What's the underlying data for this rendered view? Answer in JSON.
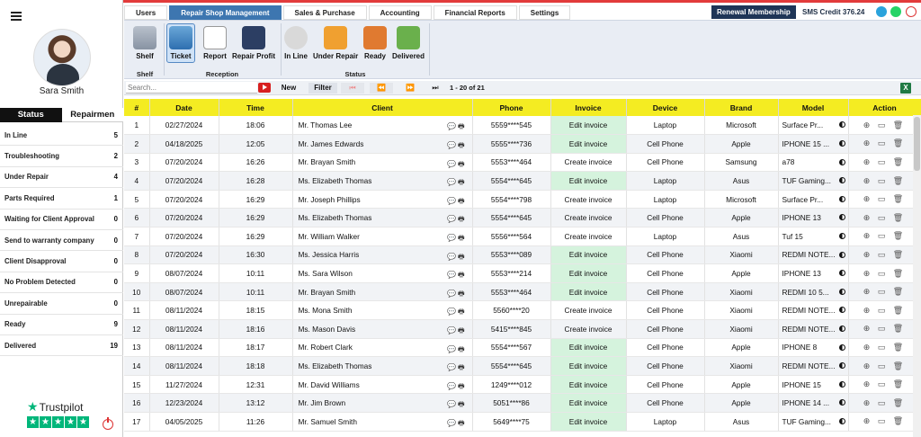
{
  "user": {
    "name": "Sara Smith"
  },
  "sidebar": {
    "tabs": [
      {
        "label": "Status"
      },
      {
        "label": "Repairmen"
      }
    ],
    "status_items": [
      {
        "label": "In Line",
        "count": "5"
      },
      {
        "label": "Troubleshooting",
        "count": "2"
      },
      {
        "label": "Under Repair",
        "count": "4"
      },
      {
        "label": "Parts Required",
        "count": "1"
      },
      {
        "label": "Waiting for Client Approval",
        "count": "0"
      },
      {
        "label": "Send to warranty company",
        "count": "0"
      },
      {
        "label": "Client Disapproval",
        "count": "0"
      },
      {
        "label": "No Problem Detected",
        "count": "0"
      },
      {
        "label": "Unrepairable",
        "count": "0"
      },
      {
        "label": "Ready",
        "count": "9"
      },
      {
        "label": "Delivered",
        "count": "19"
      }
    ],
    "trustpilot_label": "Trustpilot"
  },
  "nav": {
    "tabs": [
      {
        "label": "Users"
      },
      {
        "label": "Repair Shop Management"
      },
      {
        "label": "Sales & Purchase"
      },
      {
        "label": "Accounting"
      },
      {
        "label": "Financial Reports"
      },
      {
        "label": "Settings"
      }
    ],
    "active_tab": "Repair Shop Management",
    "renewal_label": "Renewal Membership",
    "sms_credit": "SMS Credit 376.24"
  },
  "ribbon": {
    "shelf_group": {
      "title": "Shelf",
      "buttons": [
        {
          "label": "Shelf",
          "icon": "shelf-icon"
        }
      ]
    },
    "reception_group": {
      "title": "Reception",
      "buttons": [
        {
          "label": "Ticket",
          "icon": "ticket-icon"
        },
        {
          "label": "Report",
          "icon": "report-icon"
        },
        {
          "label": "Repair Profit",
          "icon": "tools-icon"
        }
      ]
    },
    "status_group": {
      "title": "Status",
      "buttons": [
        {
          "label": "In Line",
          "icon": "clock-icon"
        },
        {
          "label": "Under Repair",
          "icon": "wrench-icon"
        },
        {
          "label": "Ready",
          "icon": "box-icon"
        },
        {
          "label": "Delivered",
          "icon": "delivered-icon"
        }
      ]
    }
  },
  "toolbar": {
    "search_placeholder": "Search...",
    "new_label": "New",
    "filter_label": "Filter",
    "first_label": "⏮",
    "prev_label": "⏪",
    "next_label": "⏩",
    "last_label": "⏭",
    "page_info": "1 - 20 of 21"
  },
  "table": {
    "columns": [
      "#",
      "Date",
      "Time",
      "Client",
      "Phone",
      "Invoice",
      "Device",
      "Brand",
      "Model",
      "Action"
    ],
    "rows": [
      {
        "n": "1",
        "date": "02/27/2024",
        "time": "18:06",
        "client": "Mr. Thomas Lee",
        "phone": "5559****545",
        "invoice": "Edit invoice",
        "device": "Laptop",
        "brand": "Microsoft",
        "model": "Surface Pr..."
      },
      {
        "n": "2",
        "date": "04/18/2025",
        "time": "12:05",
        "client": "Mr. James Edwards",
        "phone": "5555****736",
        "invoice": "Edit invoice",
        "device": "Cell Phone",
        "brand": "Apple",
        "model": "IPHONE 15 ..."
      },
      {
        "n": "3",
        "date": "07/20/2024",
        "time": "16:26",
        "client": "Mr. Brayan Smith",
        "phone": "5553****464",
        "invoice": "Create invoice",
        "device": "Cell Phone",
        "brand": "Samsung",
        "model": "a78"
      },
      {
        "n": "4",
        "date": "07/20/2024",
        "time": "16:28",
        "client": "Ms. Elizabeth Thomas",
        "phone": "5554****645",
        "invoice": "Edit invoice",
        "device": "Laptop",
        "brand": "Asus",
        "model": "TUF Gaming..."
      },
      {
        "n": "5",
        "date": "07/20/2024",
        "time": "16:29",
        "client": "Mr. Joseph Phillips",
        "phone": "5554****798",
        "invoice": "Create invoice",
        "device": "Laptop",
        "brand": "Microsoft",
        "model": "Surface Pr..."
      },
      {
        "n": "6",
        "date": "07/20/2024",
        "time": "16:29",
        "client": "Ms. Elizabeth Thomas",
        "phone": "5554****645",
        "invoice": "Create invoice",
        "device": "Cell Phone",
        "brand": "Apple",
        "model": "IPHONE 13"
      },
      {
        "n": "7",
        "date": "07/20/2024",
        "time": "16:29",
        "client": "Mr. William Walker",
        "phone": "5556****564",
        "invoice": "Create invoice",
        "device": "Laptop",
        "brand": "Asus",
        "model": "Tuf 15"
      },
      {
        "n": "8",
        "date": "07/20/2024",
        "time": "16:30",
        "client": "Ms. Jessica Harris",
        "phone": "5553****089",
        "invoice": "Edit invoice",
        "device": "Cell Phone",
        "brand": "Xiaomi",
        "model": "REDMI NOTE..."
      },
      {
        "n": "9",
        "date": "08/07/2024",
        "time": "10:11",
        "client": "Ms. Sara Wilson",
        "phone": "5553****214",
        "invoice": "Edit invoice",
        "device": "Cell Phone",
        "brand": "Apple",
        "model": "IPHONE 13"
      },
      {
        "n": "10",
        "date": "08/07/2024",
        "time": "10:11",
        "client": "Mr. Brayan Smith",
        "phone": "5553****464",
        "invoice": "Edit invoice",
        "device": "Cell Phone",
        "brand": "Xiaomi",
        "model": "REDMI 10 5..."
      },
      {
        "n": "11",
        "date": "08/11/2024",
        "time": "18:15",
        "client": "Ms. Mona Smith",
        "phone": "5560****20",
        "invoice": "Create invoice",
        "device": "Cell Phone",
        "brand": "Xiaomi",
        "model": "REDMI NOTE..."
      },
      {
        "n": "12",
        "date": "08/11/2024",
        "time": "18:16",
        "client": "Ms. Mason Davis",
        "phone": "5415****845",
        "invoice": "Create invoice",
        "device": "Cell Phone",
        "brand": "Xiaomi",
        "model": "REDMI NOTE..."
      },
      {
        "n": "13",
        "date": "08/11/2024",
        "time": "18:17",
        "client": "Mr. Robert Clark",
        "phone": "5554****567",
        "invoice": "Edit invoice",
        "device": "Cell Phone",
        "brand": "Apple",
        "model": "IPHONE 8"
      },
      {
        "n": "14",
        "date": "08/11/2024",
        "time": "18:18",
        "client": "Ms. Elizabeth Thomas",
        "phone": "5554****645",
        "invoice": "Edit invoice",
        "device": "Cell Phone",
        "brand": "Xiaomi",
        "model": "REDMI NOTE..."
      },
      {
        "n": "15",
        "date": "11/27/2024",
        "time": "12:31",
        "client": "Mr. David Williams",
        "phone": "1249****012",
        "invoice": "Edit invoice",
        "device": "Cell Phone",
        "brand": "Apple",
        "model": "IPHONE 15"
      },
      {
        "n": "16",
        "date": "12/23/2024",
        "time": "13:12",
        "client": "Mr. Jim Brown",
        "phone": "5051****86",
        "invoice": "Edit invoice",
        "device": "Cell Phone",
        "brand": "Apple",
        "model": "IPHONE 14 ..."
      },
      {
        "n": "17",
        "date": "04/05/2025",
        "time": "11:26",
        "client": "Mr. Samuel Smith",
        "phone": "5649****75",
        "invoice": "Edit invoice",
        "device": "Laptop",
        "brand": "Asus",
        "model": "TUF Gaming..."
      }
    ]
  },
  "colors": {
    "accent": "#3d76b0",
    "header_yellow": "#f4ec22",
    "edit_green": "#d5f3dd",
    "renewal_bg": "#1e3557",
    "top_line": "#e23b3b"
  }
}
